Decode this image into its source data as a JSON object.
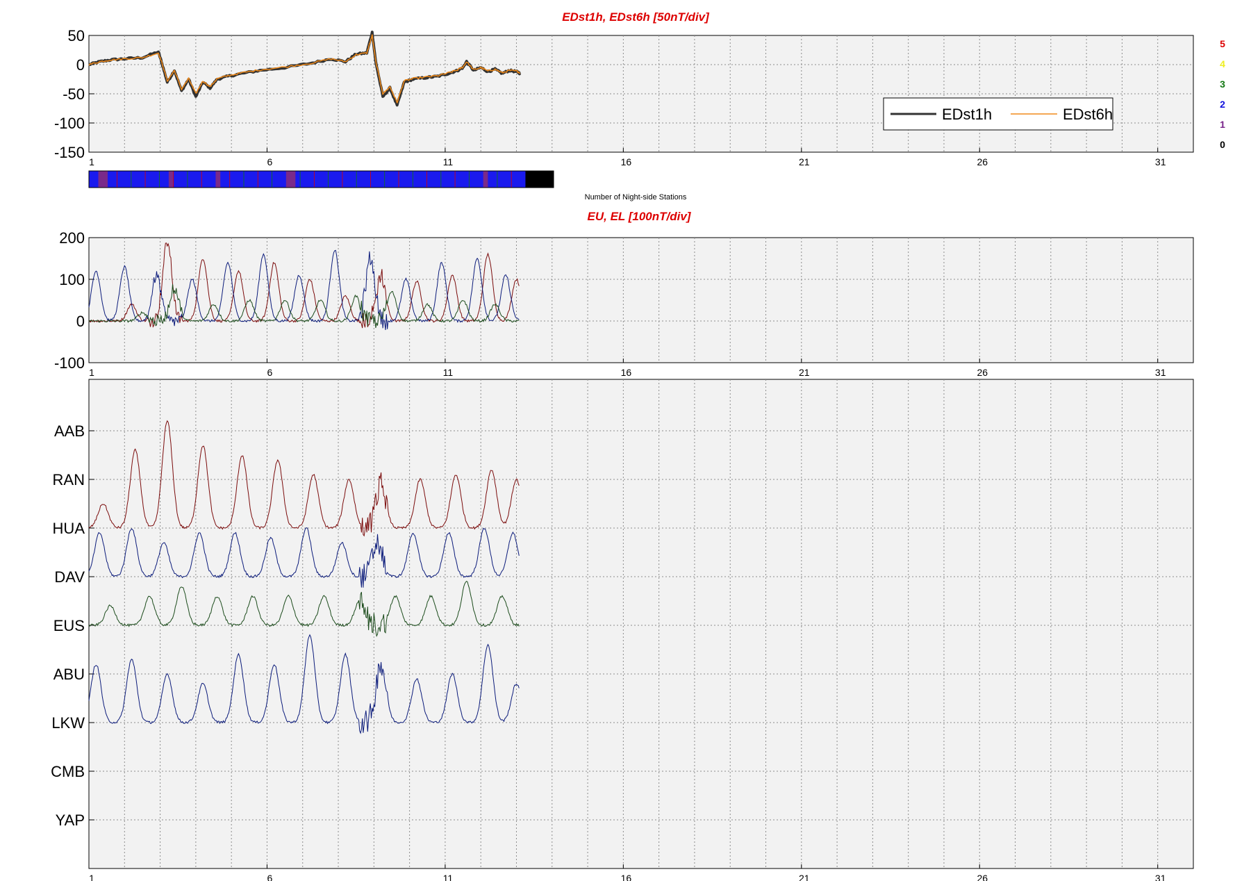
{
  "colors": {
    "title": "#dd0000",
    "axes_bg": "#f2f2f2",
    "grid": "#8c8c8c",
    "edst1h": "#333333",
    "edst6h": "#f08a1a",
    "red_trace": "#7a0a0a",
    "blue_trace": "#0a1a7a",
    "green_trace": "#1a4a1a",
    "bar_blue": "#1a1aee",
    "bar_purple": "#7a2a8a",
    "bar_black": "#000000"
  },
  "night_station_key": {
    "labels": [
      "5",
      "4",
      "3",
      "2",
      "1",
      "0"
    ],
    "colors": [
      "#dd0000",
      "#eeee22",
      "#117711",
      "#1111dd",
      "#772288",
      "#000000"
    ]
  },
  "night_station_bar": {
    "label": "Number of Night-side Stations",
    "counts": [
      2,
      2,
      1,
      1,
      2,
      2,
      2,
      2,
      2,
      2,
      2,
      2,
      2,
      2,
      2,
      2,
      2,
      1,
      2,
      2,
      2,
      2,
      2,
      2,
      2,
      2,
      2,
      1,
      2,
      2,
      2,
      2,
      2,
      2,
      2,
      2,
      2,
      2,
      2,
      2,
      2,
      2,
      1,
      1,
      2,
      2,
      2,
      2,
      2,
      2,
      2,
      2,
      2,
      2,
      2,
      2,
      2,
      2,
      2,
      2,
      2,
      2,
      2,
      2,
      2,
      2,
      2,
      2,
      2,
      2,
      2,
      2,
      2,
      2,
      2,
      2,
      2,
      2,
      2,
      2,
      2,
      2,
      2,
      2,
      1,
      2,
      2,
      2,
      2,
      2,
      2,
      2,
      2,
      0,
      0,
      0,
      0,
      0,
      0
    ]
  },
  "chart_data": [
    {
      "type": "line",
      "title": "EDst1h, EDst6h [50nT/div]",
      "xlabel": "",
      "ylabel": "",
      "xlim": [
        1,
        32
      ],
      "ylim": [
        -150,
        50
      ],
      "x_ticks": [
        1,
        6,
        11,
        16,
        21,
        26,
        31
      ],
      "y_ticks": [
        50,
        0,
        -50,
        -100,
        -150
      ],
      "grid": true,
      "legend": {
        "placement": "lower-right",
        "entries": [
          "EDst1h",
          "EDst6h"
        ]
      },
      "series": [
        {
          "name": "EDst1h",
          "x": [
            1.0,
            1.3,
            1.6,
            2.0,
            2.5,
            2.95,
            3.05,
            3.2,
            3.4,
            3.6,
            3.8,
            4.0,
            4.2,
            4.4,
            4.6,
            4.9,
            5.3,
            5.8,
            6.5,
            7.2,
            7.8,
            8.2,
            8.5,
            8.8,
            8.95,
            9.05,
            9.25,
            9.45,
            9.65,
            9.85,
            10.1,
            10.5,
            10.8,
            11.1,
            11.35,
            11.5,
            11.6,
            11.8,
            12.0,
            12.2,
            12.4,
            12.6,
            12.8,
            13.0,
            13.1
          ],
          "y": [
            0,
            5,
            8,
            10,
            12,
            22,
            2,
            -30,
            -10,
            -45,
            -25,
            -55,
            -30,
            -40,
            -25,
            -20,
            -15,
            -10,
            -5,
            2,
            10,
            5,
            18,
            20,
            55,
            5,
            -55,
            -40,
            -70,
            -30,
            -25,
            -22,
            -20,
            -15,
            -10,
            -5,
            5,
            -10,
            -5,
            -12,
            -8,
            -15,
            -10,
            -12,
            -15
          ]
        },
        {
          "name": "EDst6h",
          "x": [
            1.0,
            1.3,
            1.6,
            2.0,
            2.5,
            2.95,
            3.05,
            3.2,
            3.4,
            3.6,
            3.8,
            4.0,
            4.2,
            4.4,
            4.6,
            4.9,
            5.3,
            5.8,
            6.5,
            7.2,
            7.8,
            8.2,
            8.5,
            8.8,
            8.95,
            9.05,
            9.25,
            9.45,
            9.65,
            9.85,
            10.1,
            10.5,
            10.8,
            11.1,
            11.35,
            11.5,
            11.6,
            11.8,
            12.0,
            12.2,
            12.4,
            12.6,
            12.8,
            13.0,
            13.1
          ],
          "y": [
            0,
            5,
            8,
            10,
            12,
            20,
            3,
            -28,
            -10,
            -42,
            -24,
            -50,
            -28,
            -38,
            -24,
            -19,
            -14,
            -9,
            -4,
            2,
            10,
            5,
            17,
            20,
            50,
            6,
            -50,
            -38,
            -65,
            -28,
            -24,
            -21,
            -19,
            -14,
            -9,
            -4,
            5,
            -9,
            -5,
            -11,
            -8,
            -14,
            -10,
            -11,
            -14
          ]
        }
      ]
    },
    {
      "type": "line",
      "title": "EU, EL   [100nT/div]",
      "xlabel": "",
      "ylabel": "",
      "xlim": [
        1,
        32
      ],
      "ylim": [
        -100,
        200
      ],
      "x_ticks": [
        1,
        6,
        11,
        16,
        21,
        26,
        31
      ],
      "y_ticks": [
        200,
        100,
        0,
        -100
      ],
      "grid": true,
      "series": [
        {
          "color_key": "red_trace",
          "peak_x": [
            2.2,
            3.2,
            4.2,
            5.2,
            6.2,
            7.2,
            8.2,
            9.2,
            10.2,
            11.2,
            12.2,
            13.0
          ],
          "peak_y": [
            40,
            190,
            150,
            120,
            140,
            100,
            60,
            110,
            95,
            110,
            160,
            100
          ]
        },
        {
          "color_key": "blue_trace",
          "peak_x": [
            1.2,
            2.0,
            2.9,
            3.9,
            4.9,
            5.9,
            6.9,
            7.9,
            8.9,
            9.9,
            10.9,
            11.9,
            12.7
          ],
          "peak_y": [
            120,
            130,
            110,
            100,
            140,
            160,
            110,
            170,
            150,
            100,
            140,
            150,
            110
          ]
        },
        {
          "color_key": "green_trace",
          "peak_x": [
            2.5,
            3.4,
            4.5,
            5.5,
            6.5,
            7.5,
            8.5,
            9.5,
            10.5,
            11.5,
            12.4
          ],
          "peak_y": [
            20,
            80,
            40,
            50,
            50,
            50,
            60,
            70,
            40,
            50,
            40
          ]
        }
      ]
    },
    {
      "type": "line",
      "title": "",
      "xlabel": "",
      "ylabel": "",
      "xlim": [
        1,
        32
      ],
      "categories": [
        "AAB",
        "RAN",
        "HUA",
        "DAV",
        "EUS",
        "ABU",
        "LKW",
        "CMB",
        "YAP"
      ],
      "x_ticks": [
        1,
        6,
        11,
        16,
        21,
        26,
        31
      ],
      "grid": true,
      "traces": [
        {
          "station": "HUA",
          "color_key": "red_trace",
          "peak_x": [
            1.4,
            2.3,
            3.2,
            4.2,
            5.3,
            6.3,
            7.3,
            8.3,
            9.2,
            10.3,
            11.3,
            12.3,
            13.0
          ],
          "peak_y": [
            0.5,
            1.6,
            2.2,
            1.7,
            1.5,
            1.4,
            1.1,
            1.0,
            0.9,
            1.0,
            1.1,
            1.2,
            1.0
          ]
        },
        {
          "station": "DAV",
          "color_key": "blue_trace",
          "peak_x": [
            1.3,
            2.2,
            3.1,
            4.1,
            5.1,
            6.1,
            7.1,
            8.1,
            9.1,
            10.1,
            11.1,
            12.1,
            12.9
          ],
          "peak_y": [
            0.9,
            1.0,
            0.7,
            0.9,
            0.9,
            0.8,
            1.0,
            0.7,
            0.7,
            0.9,
            0.9,
            1.0,
            0.9
          ]
        },
        {
          "station": "EUS",
          "color_key": "green_trace",
          "peak_x": [
            1.6,
            2.7,
            3.6,
            4.6,
            5.6,
            6.6,
            7.6,
            8.6,
            9.6,
            10.6,
            11.6,
            12.6
          ],
          "peak_y": [
            0.4,
            0.6,
            0.8,
            0.6,
            0.6,
            0.6,
            0.6,
            0.5,
            0.6,
            0.6,
            0.9,
            0.6
          ]
        },
        {
          "station": "LKW",
          "color_key": "blue_trace",
          "peak_x": [
            1.2,
            2.2,
            3.2,
            4.2,
            5.2,
            6.2,
            7.2,
            8.2,
            9.2,
            10.2,
            11.2,
            12.2,
            13.0
          ],
          "peak_y": [
            1.2,
            1.3,
            1.0,
            0.8,
            1.4,
            1.2,
            1.8,
            1.4,
            1.2,
            0.9,
            1.0,
            1.6,
            0.8
          ]
        }
      ]
    }
  ]
}
